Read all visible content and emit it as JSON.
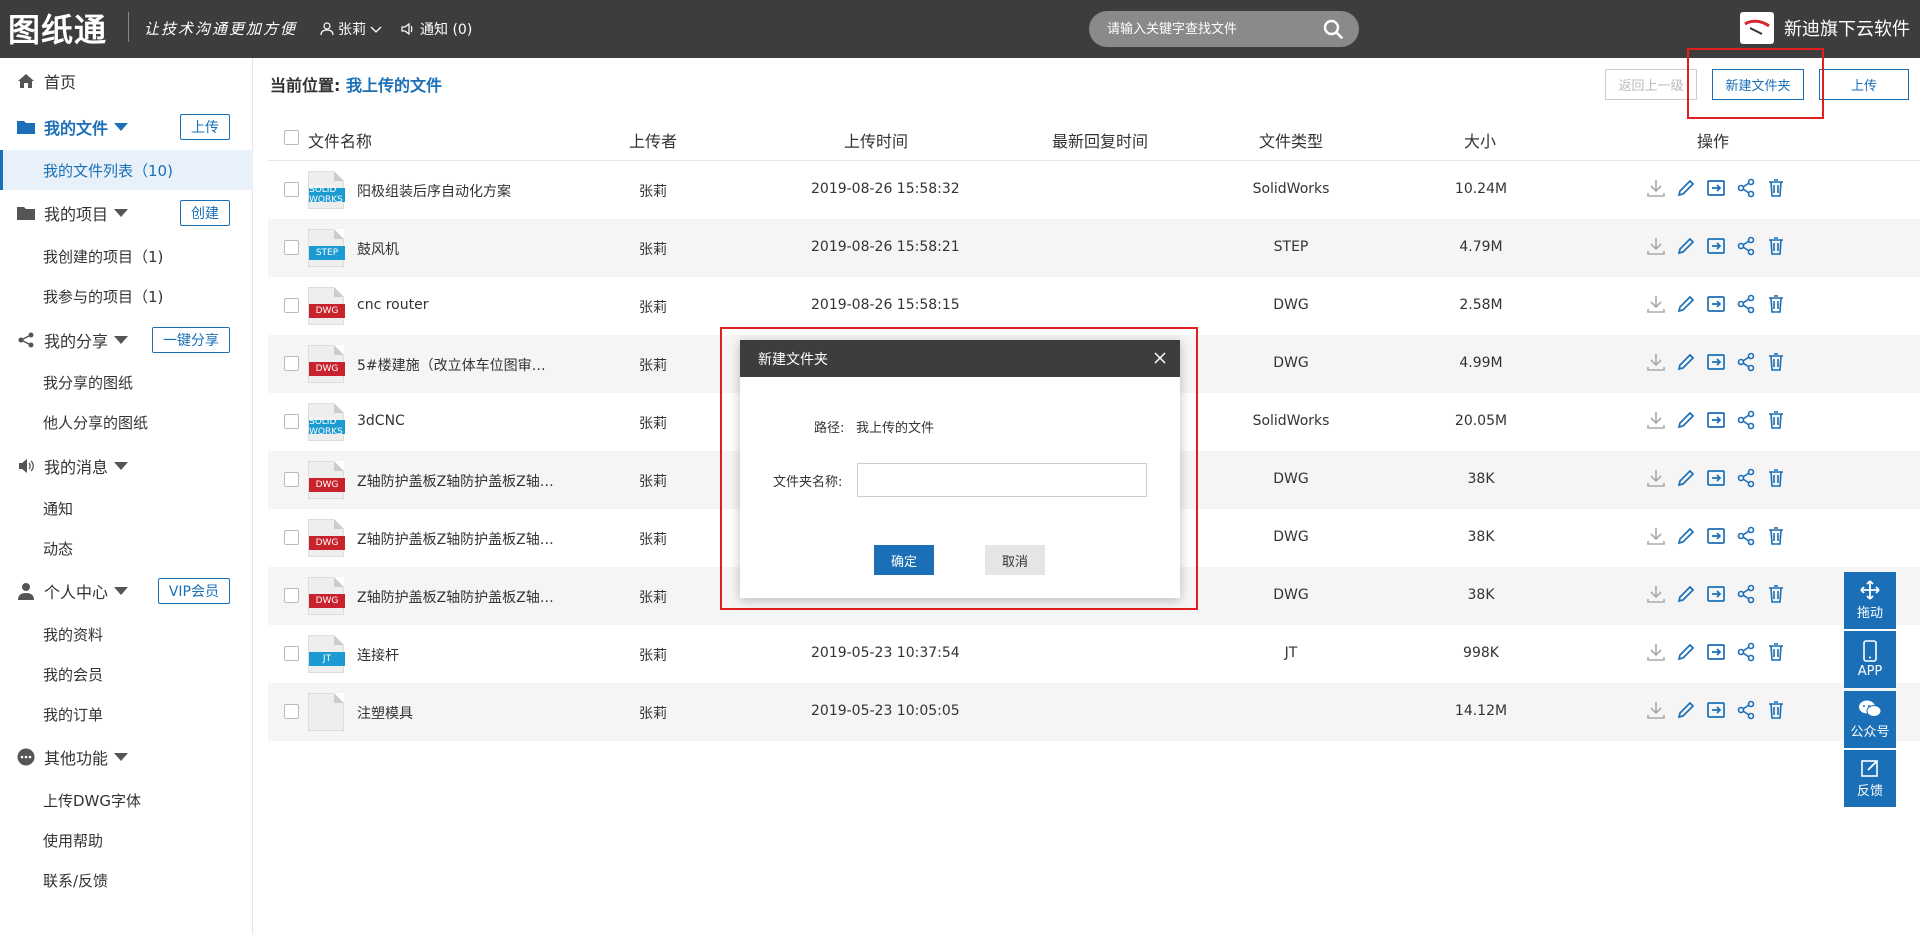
{
  "header": {
    "logo": "图纸通",
    "slogan": "让技术沟通更加方便",
    "user": "张莉",
    "notify": "通知 (0)",
    "search_placeholder": "请输入关键字查找文件",
    "brand": "新迪旗下云软件"
  },
  "sidebar": {
    "home": "首页",
    "my_files": "我的文件",
    "upload_btn": "上传",
    "my_file_list": "我的文件列表（10)",
    "my_projects": "我的项目",
    "create_btn": "创建",
    "created_projects": "我创建的项目（1)",
    "joined_projects": "我参与的项目（1)",
    "my_share": "我的分享",
    "share_btn": "一键分享",
    "shared_drawings": "我分享的图纸",
    "others_shared": "他人分享的图纸",
    "my_messages": "我的消息",
    "notice": "通知",
    "activity": "动态",
    "personal_center": "个人中心",
    "vip_btn": "VIP会员",
    "my_profile": "我的资料",
    "my_membership": "我的会员",
    "my_orders": "我的订单",
    "other_functions": "其他功能",
    "upload_font": "上传DWG字体",
    "help": "使用帮助",
    "contact": "联系/反馈"
  },
  "main": {
    "breadcrumb_label": "当前位置:",
    "breadcrumb_current": "我上传的文件",
    "back_btn": "返回上一级",
    "new_folder_btn": "新建文件夹",
    "upload_btn": "上传",
    "columns": [
      "文件名称",
      "上传者",
      "上传时间",
      "最新回复时间",
      "文件类型",
      "大小",
      "操作"
    ],
    "rows": [
      {
        "icon": "SOLID WORKS",
        "icon_color": "#1b9bd1",
        "name": "阳极组装后序自动化方案",
        "uploader": "张莉",
        "time": "2019-08-26 15:58:32",
        "reply": "",
        "type": "SolidWorks",
        "size": "10.24M"
      },
      {
        "icon": "STEP",
        "icon_color": "#1b9bd1",
        "name": "鼓风机",
        "uploader": "张莉",
        "time": "2019-08-26 15:58:21",
        "reply": "",
        "type": "STEP",
        "size": "4.79M"
      },
      {
        "icon": "DWG",
        "icon_color": "#c8232c",
        "name": "cnc router",
        "uploader": "张莉",
        "time": "2019-08-26 15:58:15",
        "reply": "",
        "type": "DWG",
        "size": "2.58M"
      },
      {
        "icon": "DWG",
        "icon_color": "#c8232c",
        "name": "5#楼建施（改立体车位图审…",
        "uploader": "张莉",
        "time": "",
        "reply": "",
        "type": "DWG",
        "size": "4.99M"
      },
      {
        "icon": "SOLID WORKS",
        "icon_color": "#1b9bd1",
        "name": "3dCNC",
        "uploader": "张莉",
        "time": "",
        "reply": "",
        "type": "SolidWorks",
        "size": "20.05M"
      },
      {
        "icon": "DWG",
        "icon_color": "#c8232c",
        "name": "Z轴防护盖板Z轴防护盖板Z轴…",
        "uploader": "张莉",
        "time": "",
        "reply": "",
        "type": "DWG",
        "size": "38K"
      },
      {
        "icon": "DWG",
        "icon_color": "#c8232c",
        "name": "Z轴防护盖板Z轴防护盖板Z轴…",
        "uploader": "张莉",
        "time": "",
        "reply": "",
        "type": "DWG",
        "size": "38K"
      },
      {
        "icon": "DWG",
        "icon_color": "#c8232c",
        "name": "Z轴防护盖板Z轴防护盖板Z轴…",
        "uploader": "张莉",
        "time": "",
        "reply": "",
        "type": "DWG",
        "size": "38K"
      },
      {
        "icon": "JT",
        "icon_color": "#1b9bd1",
        "name": "连接杆",
        "uploader": "张莉",
        "time": "2019-05-23 10:37:54",
        "reply": "",
        "type": "JT",
        "size": "998K"
      },
      {
        "icon": "",
        "icon_color": "#e0e0e0",
        "name": "注塑模具",
        "uploader": "张莉",
        "time": "2019-05-23 10:05:05",
        "reply": "",
        "type": "",
        "size": "14.12M"
      }
    ]
  },
  "modal": {
    "title": "新建文件夹",
    "path_label": "路径:",
    "path_value": "我上传的文件",
    "name_label": "文件夹名称:",
    "name_value": "",
    "ok": "确定",
    "cancel": "取消"
  },
  "float_bar": {
    "drag": "拖动",
    "app": "APP",
    "wechat": "公众号",
    "feedback": "反馈"
  },
  "colors": {
    "accent": "#1a6fb7",
    "header_bg": "#3d3d3d",
    "highlight": "#e02020"
  }
}
